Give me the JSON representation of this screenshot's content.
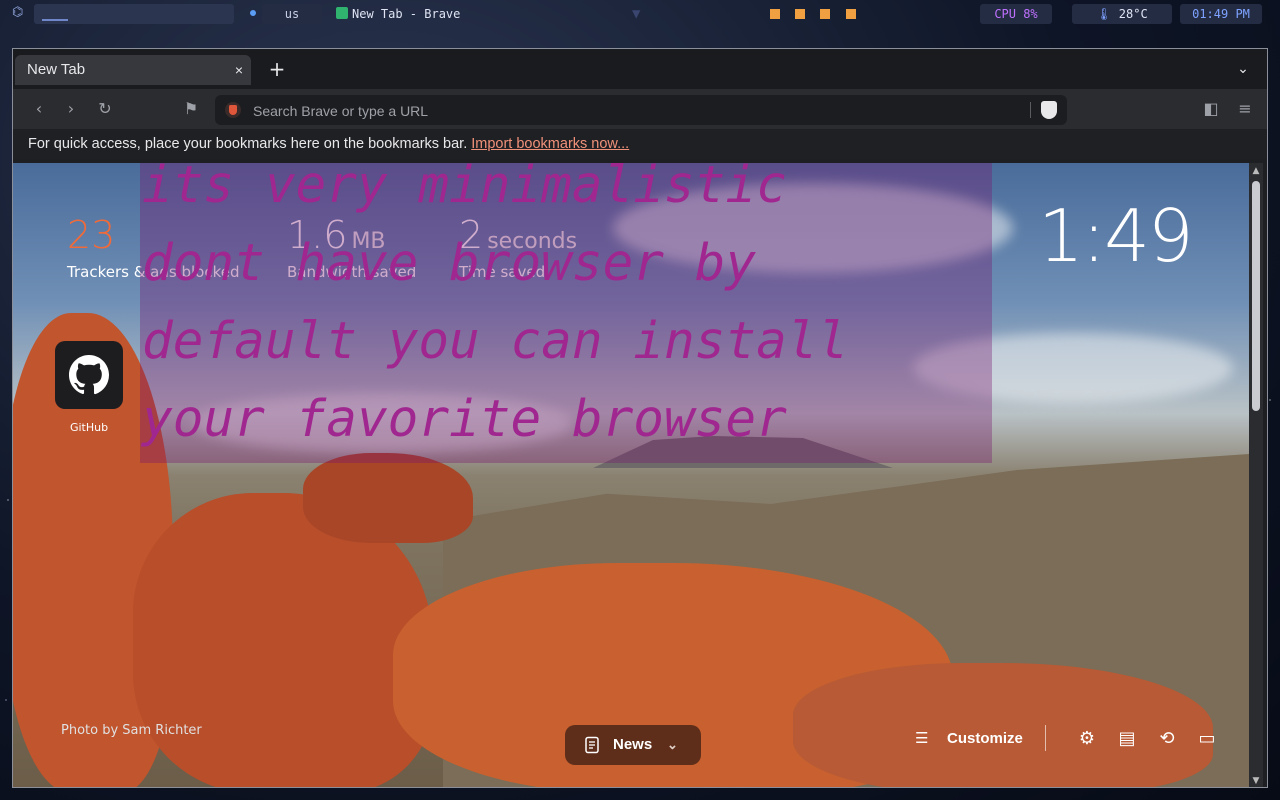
{
  "system_bar": {
    "keyboard_layout": "us",
    "window_title": "New Tab - Brave",
    "cpu": "CPU 8%",
    "temperature": "28°C",
    "clock": "01:49 PM"
  },
  "browser": {
    "tab": {
      "title": "New Tab",
      "close": "×"
    },
    "new_tab": "+",
    "omnibox_placeholder": "Search Brave or type a URL",
    "bookmarks_bar": {
      "message": "For quick access, place your bookmarks here on the bookmarks bar.",
      "import_link": "Import bookmarks now..."
    }
  },
  "new_tab_page": {
    "stats": [
      {
        "value": "23",
        "unit": "",
        "label": "Trackers & ads blocked",
        "color": "#f06a3a"
      },
      {
        "value": "1.6",
        "unit": "MB",
        "label": "Bandwidth saved",
        "color": "#ffffff"
      },
      {
        "value": "2",
        "unit": "seconds",
        "label": "Time saved",
        "color": "#ffffff"
      }
    ],
    "clock": "1:49",
    "top_sites": [
      {
        "name": "GitHub",
        "icon": "github-icon"
      }
    ],
    "overlay_text": "its very minimalistic\ndont have browser by\ndefault you can install\nyour favorite browser",
    "photo_credit": "Photo by Sam Richter",
    "news_button": "News",
    "customize_button": "Customize"
  }
}
